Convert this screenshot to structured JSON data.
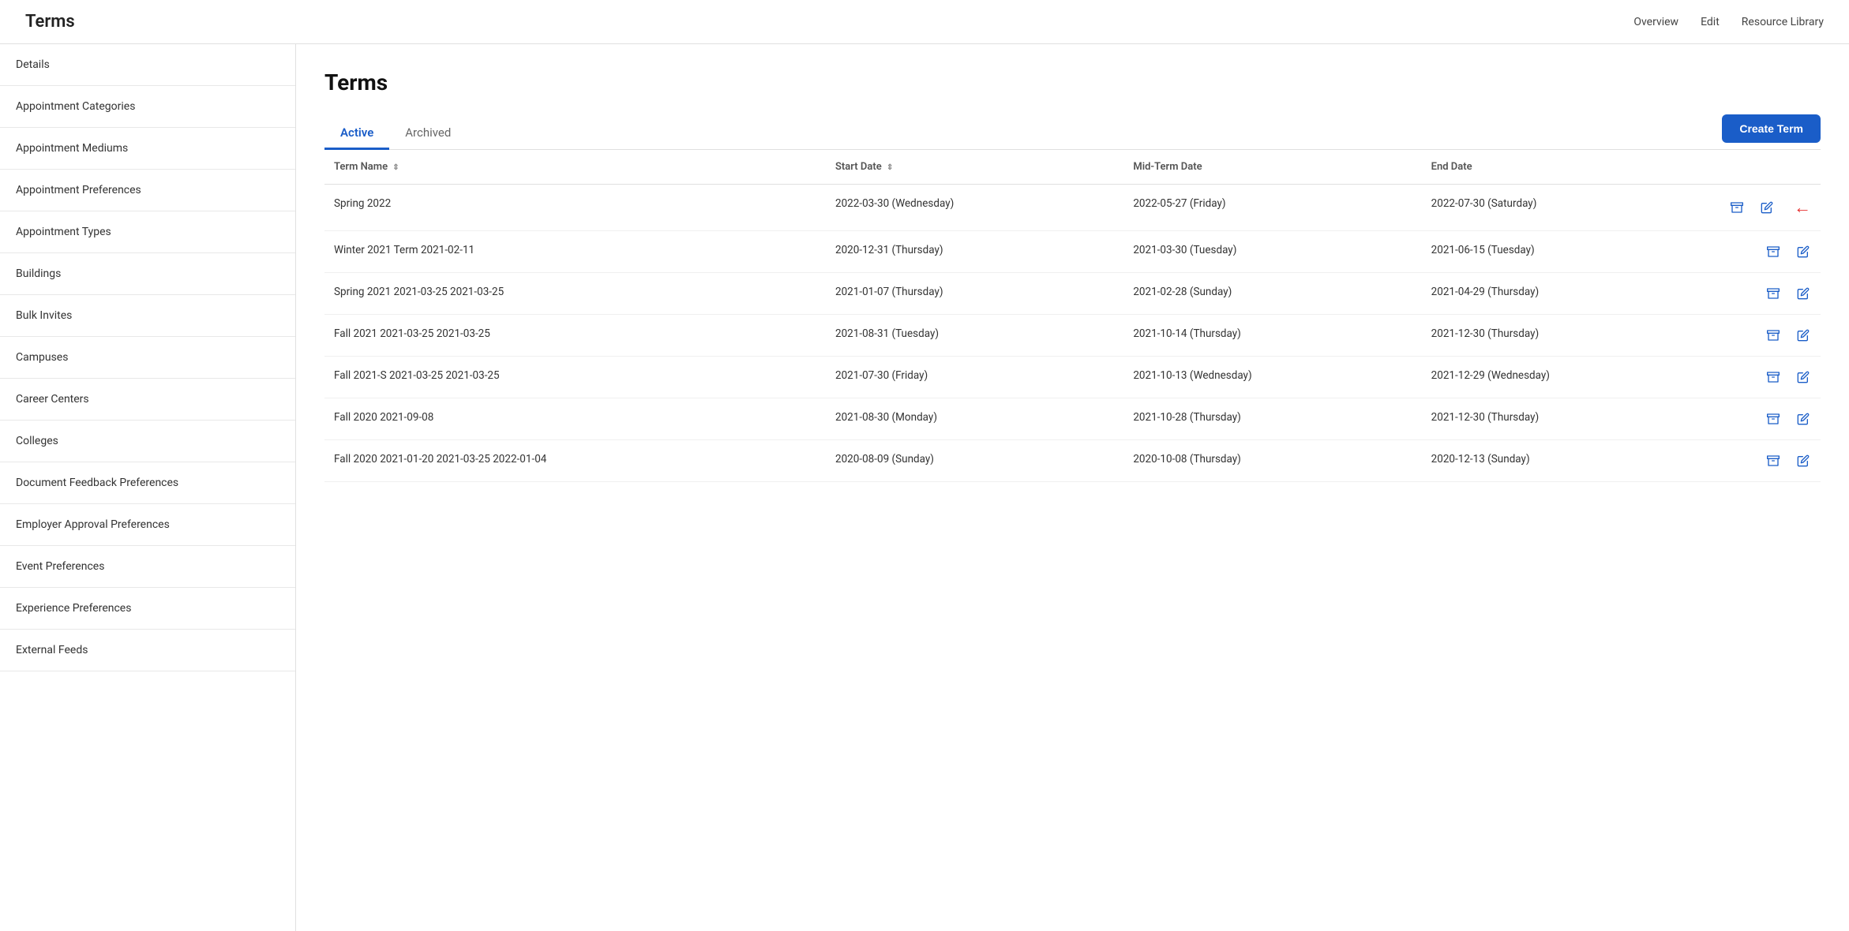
{
  "topNav": {
    "title": "Terms",
    "links": [
      "Overview",
      "Edit",
      "Resource Library"
    ]
  },
  "sidebar": {
    "items": [
      {
        "id": "details",
        "label": "Details"
      },
      {
        "id": "appointment-categories",
        "label": "Appointment Categories"
      },
      {
        "id": "appointment-mediums",
        "label": "Appointment Mediums"
      },
      {
        "id": "appointment-preferences",
        "label": "Appointment Preferences"
      },
      {
        "id": "appointment-types",
        "label": "Appointment Types"
      },
      {
        "id": "buildings",
        "label": "Buildings"
      },
      {
        "id": "bulk-invites",
        "label": "Bulk Invites"
      },
      {
        "id": "campuses",
        "label": "Campuses"
      },
      {
        "id": "career-centers",
        "label": "Career Centers"
      },
      {
        "id": "colleges",
        "label": "Colleges"
      },
      {
        "id": "document-feedback-preferences",
        "label": "Document Feedback Preferences"
      },
      {
        "id": "employer-approval-preferences",
        "label": "Employer Approval Preferences"
      },
      {
        "id": "event-preferences",
        "label": "Event Preferences"
      },
      {
        "id": "experience-preferences",
        "label": "Experience Preferences"
      },
      {
        "id": "external-feeds",
        "label": "External Feeds"
      }
    ]
  },
  "main": {
    "title": "Terms",
    "tabs": [
      {
        "id": "active",
        "label": "Active",
        "active": true
      },
      {
        "id": "archived",
        "label": "Archived",
        "active": false
      }
    ],
    "createButton": "Create Term",
    "table": {
      "columns": [
        {
          "id": "term-name",
          "label": "Term Name",
          "sortable": true
        },
        {
          "id": "start-date",
          "label": "Start Date",
          "sortable": true
        },
        {
          "id": "mid-term-date",
          "label": "Mid-Term Date",
          "sortable": false
        },
        {
          "id": "end-date",
          "label": "End Date",
          "sortable": false
        }
      ],
      "rows": [
        {
          "termName": "Spring 2022",
          "startDate": "2022-03-30 (Wednesday)",
          "midTermDate": "2022-05-27 (Friday)",
          "endDate": "2022-07-30 (Saturday)",
          "hasArrow": true
        },
        {
          "termName": "Winter 2021 Term 2021-02-11",
          "startDate": "2020-12-31 (Thursday)",
          "midTermDate": "2021-03-30 (Tuesday)",
          "endDate": "2021-06-15 (Tuesday)",
          "hasArrow": false
        },
        {
          "termName": "Spring 2021 2021-03-25 2021-03-25",
          "startDate": "2021-01-07 (Thursday)",
          "midTermDate": "2021-02-28 (Sunday)",
          "endDate": "2021-04-29 (Thursday)",
          "hasArrow": false
        },
        {
          "termName": "Fall 2021 2021-03-25 2021-03-25",
          "startDate": "2021-08-31 (Tuesday)",
          "midTermDate": "2021-10-14 (Thursday)",
          "endDate": "2021-12-30 (Thursday)",
          "hasArrow": false
        },
        {
          "termName": "Fall 2021-S 2021-03-25 2021-03-25",
          "startDate": "2021-07-30 (Friday)",
          "midTermDate": "2021-10-13 (Wednesday)",
          "endDate": "2021-12-29 (Wednesday)",
          "hasArrow": false
        },
        {
          "termName": "Fall 2020 2021-09-08",
          "startDate": "2021-08-30 (Monday)",
          "midTermDate": "2021-10-28 (Thursday)",
          "endDate": "2021-12-30 (Thursday)",
          "hasArrow": false
        },
        {
          "termName": "Fall 2020 2021-01-20 2021-03-25 2022-01-04",
          "startDate": "2020-08-09 (Sunday)",
          "midTermDate": "2020-10-08 (Thursday)",
          "endDate": "2020-12-13 (Sunday)",
          "hasArrow": false
        }
      ]
    }
  }
}
